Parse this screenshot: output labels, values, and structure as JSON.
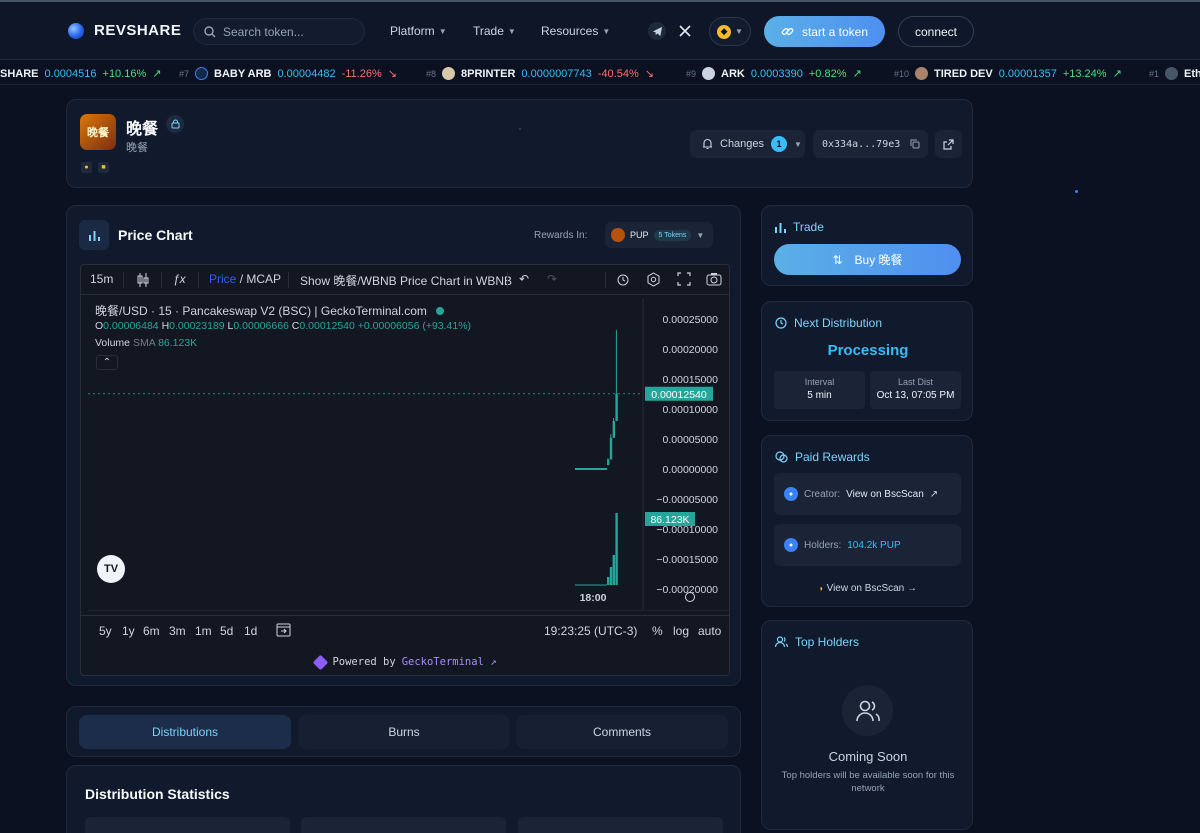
{
  "header": {
    "logo": "REVSHARE",
    "search_placeholder": "Search token...",
    "nav": [
      "Platform",
      "Trade",
      "Resources"
    ],
    "start_token": "start a token",
    "connect": "connect"
  },
  "ticker": [
    {
      "rank": "",
      "symbol": "SHARE",
      "price": "0.0004516",
      "change": "+10.16%",
      "dir": "up"
    },
    {
      "rank": "#7",
      "symbol": "BABY ARB",
      "price": "0.00004482",
      "change": "-11.26%",
      "dir": "down"
    },
    {
      "rank": "#8",
      "symbol": "8PRINTER",
      "price": "0.0000007743",
      "change": "-40.54%",
      "dir": "down"
    },
    {
      "rank": "#9",
      "symbol": "ARK",
      "price": "0.0003390",
      "change": "+0.82%",
      "dir": "up"
    },
    {
      "rank": "#10",
      "symbol": "TIRED DEV",
      "price": "0.00001357",
      "change": "+13.24%",
      "dir": "up"
    },
    {
      "rank": "#1",
      "symbol": "Eth",
      "price": "",
      "change": "",
      "dir": "up"
    }
  ],
  "token": {
    "name": "晚餐",
    "subtitle": "晚餐",
    "img_text": "晚餐",
    "changes_label": "Changes",
    "changes_count": "1",
    "address": "0x334a...79e3"
  },
  "price_chart": {
    "title": "Price Chart",
    "rewards_in": "Rewards In:",
    "reward_token": "PUP",
    "reward_tokens_pill": "5 Tokens",
    "toolbar": {
      "interval": "15m",
      "price": "Price",
      "mcap": "/ MCAP",
      "show_wbnb": "Show 晚餐/WBNB Price Chart in WBNB"
    },
    "legend": "晚餐/USD · 15 · Pancakeswap V2 (BSC) | GeckoTerminal.com",
    "ohlc": {
      "o": "0.00006484",
      "h": "0.00023189",
      "l": "0.00006666",
      "c": "0.00012540",
      "change": "+0.00006056 (+93.41%)"
    },
    "volume_label": "Volume",
    "sma_label": "SMA",
    "volume_value": "86.123K",
    "y_ticks": [
      "0.00025000",
      "0.00020000",
      "0.00015000",
      "0.00010000",
      "0.00005000",
      "0.00000000",
      "−0.00005000",
      "−0.00010000",
      "−0.00015000",
      "−0.00020000"
    ],
    "last_price_tag": "0.00012540",
    "volume_tag": "86.123K",
    "x_label": "18:00",
    "ranges": [
      "5y",
      "1y",
      "6m",
      "3m",
      "1m",
      "5d",
      "1d"
    ],
    "time": "19:23:25 (UTC-3)",
    "scale_opts": [
      "%",
      "log",
      "auto"
    ],
    "powered_by": "Powered by",
    "powered_src": "GeckoTerminal ↗"
  },
  "tabs": [
    "Distributions",
    "Burns",
    "Comments"
  ],
  "distribution": {
    "title": "Distribution Statistics"
  },
  "trade": {
    "title": "Trade",
    "buy": "Buy 晚餐"
  },
  "next_distribution": {
    "title": "Next Distribution",
    "status": "Processing",
    "interval_label": "Interval",
    "interval_value": "5 min",
    "last_label": "Last Dist",
    "last_value": "Oct 13, 07:05 PM"
  },
  "paid_rewards": {
    "title": "Paid Rewards",
    "creator_label": "Creator:",
    "creator_link": "View on BscScan",
    "holders_label": "Holders:",
    "holders_value": "104.2k PUP",
    "bscscan": "View on BscScan"
  },
  "top_holders": {
    "title": "Top Holders",
    "coming_soon": "Coming Soon",
    "note": "Top holders will be available soon for this network"
  },
  "colors": {
    "accent": "#38bdf8",
    "button": "#4f8ff0",
    "up": "#26a69a",
    "down": "#f87171"
  }
}
